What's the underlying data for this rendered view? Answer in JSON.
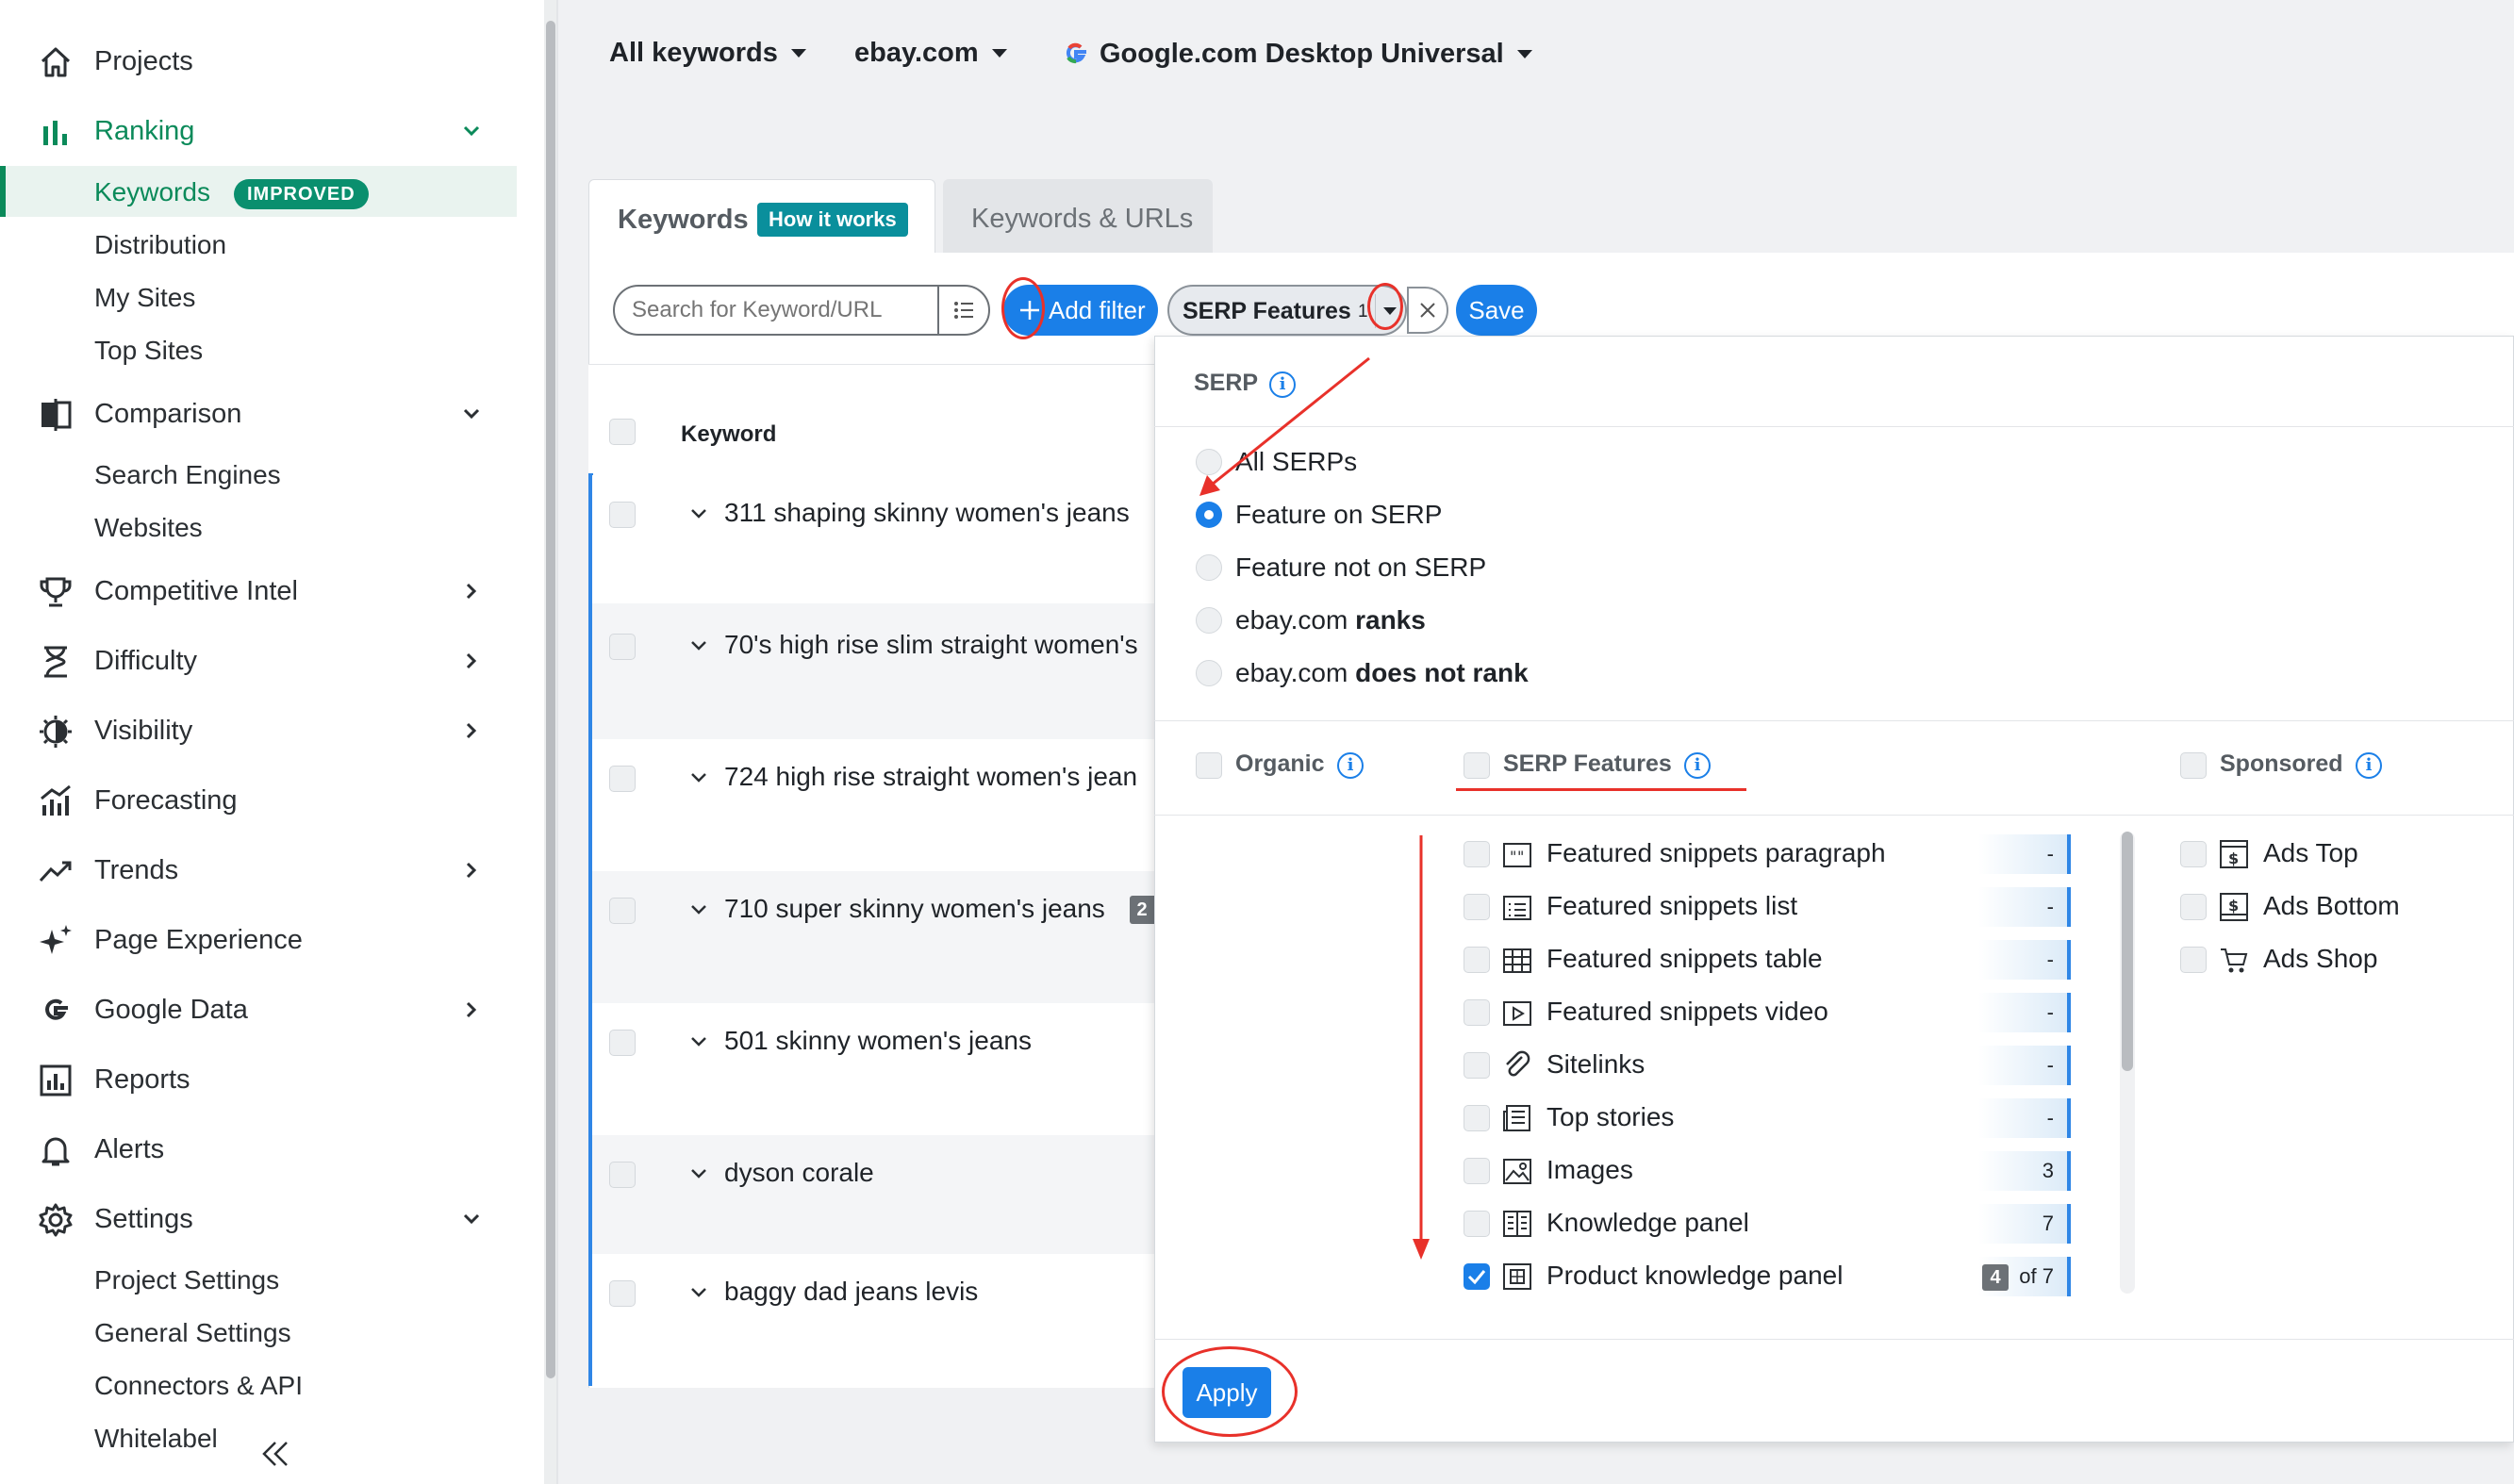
{
  "sidebar": {
    "projects": "Projects",
    "ranking": "Ranking",
    "ranking_sub": [
      "Keywords",
      "Distribution",
      "My Sites",
      "Top Sites"
    ],
    "improved_badge": "IMPROVED",
    "comparison": "Comparison",
    "comparison_sub": [
      "Search Engines",
      "Websites"
    ],
    "competitive_intel": "Competitive Intel",
    "difficulty": "Difficulty",
    "visibility": "Visibility",
    "forecasting": "Forecasting",
    "trends": "Trends",
    "page_experience": "Page Experience",
    "google_data": "Google Data",
    "reports": "Reports",
    "alerts": "Alerts",
    "settings": "Settings",
    "settings_sub": [
      "Project Settings",
      "General Settings",
      "Connectors & API",
      "Whitelabel"
    ],
    "accent_color": "#0b8a5a"
  },
  "topbar": {
    "keywords_dropdown": "All keywords",
    "site_dropdown": "ebay.com",
    "engine_dropdown": "Google.com Desktop Universal"
  },
  "tabs": {
    "keywords": "Keywords",
    "how_it_works": "How it works",
    "keywords_urls": "Keywords & URLs"
  },
  "toolbar": {
    "search_placeholder": "Search for Keyword/URL",
    "add_filter": "Add filter",
    "chip_label": "SERP Features",
    "chip_count": "1",
    "save": "Save"
  },
  "table": {
    "header_keyword": "Keyword",
    "rows": [
      {
        "keyword": "311 shaping skinny women's jeans"
      },
      {
        "keyword": "70's high rise slim straight women's"
      },
      {
        "keyword": "724 high rise straight women's jean"
      },
      {
        "keyword": "710 super skinny women's jeans",
        "badge": "2"
      },
      {
        "keyword": "501 skinny women's jeans"
      },
      {
        "keyword": "dyson corale"
      },
      {
        "keyword": "baggy dad jeans levis"
      }
    ]
  },
  "panel": {
    "serp_title": "SERP",
    "radios": [
      {
        "label": "All SERPs"
      },
      {
        "label": "Feature on SERP"
      },
      {
        "label": "Feature not on SERP"
      },
      {
        "prefix": "ebay.com ",
        "bold": "ranks"
      },
      {
        "prefix": "ebay.com ",
        "bold": "does not rank"
      }
    ],
    "organic": "Organic",
    "serp_features": "SERP Features",
    "sponsored": "Sponsored",
    "features": [
      {
        "label": "Featured snippets paragraph",
        "count": "-"
      },
      {
        "label": "Featured snippets list",
        "count": "-"
      },
      {
        "label": "Featured snippets table",
        "count": "-"
      },
      {
        "label": "Featured snippets video",
        "count": "-"
      },
      {
        "label": "Sitelinks",
        "count": "-"
      },
      {
        "label": "Top stories",
        "count": "-"
      },
      {
        "label": "Images",
        "count": "3"
      },
      {
        "label": "Knowledge panel",
        "count": "7"
      },
      {
        "label": "Product knowledge panel",
        "count_badge": "4",
        "count_suffix": "of 7"
      }
    ],
    "sponsored_items": [
      "Ads Top",
      "Ads Bottom",
      "Ads Shop"
    ],
    "apply": "Apply"
  },
  "colors": {
    "primary_blue": "#1a7fe8",
    "annotation_red": "#e8312a",
    "improved_green": "#0a8f6e"
  }
}
